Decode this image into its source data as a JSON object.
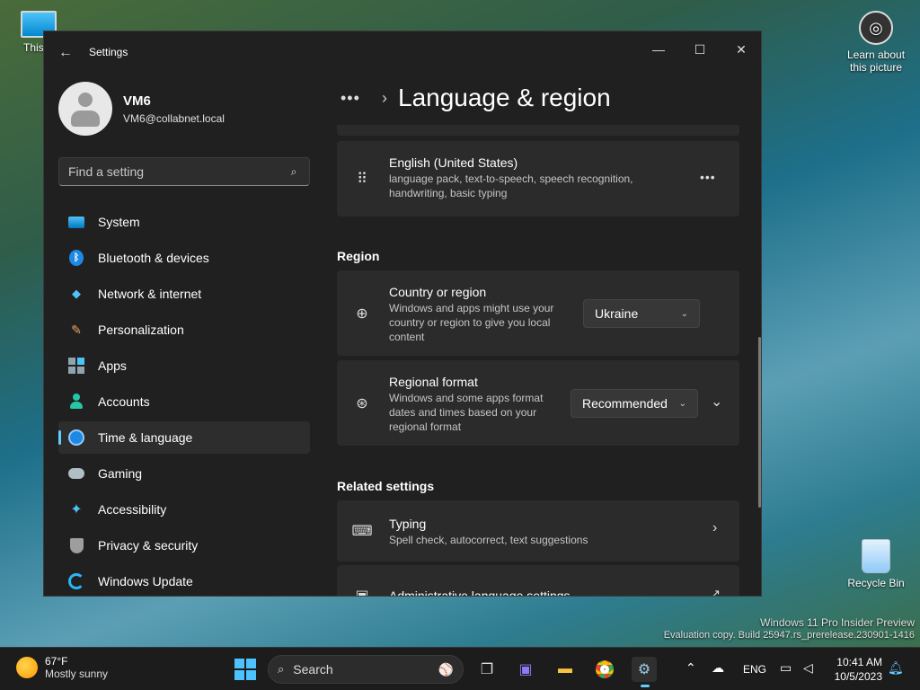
{
  "desktop": {
    "this_pc_label": "This P",
    "learn_label_1": "Learn about",
    "learn_label_2": "this picture",
    "recycle_label": "Recycle Bin",
    "watermark_line1": "Windows 11 Pro Insider Preview",
    "watermark_line2": "Evaluation copy. Build 25947.rs_prerelease.230901-1416"
  },
  "window": {
    "title": "Settings",
    "controls": {
      "minimize": "—",
      "maximize": "☐",
      "close": "✕"
    }
  },
  "profile": {
    "name": "VM6",
    "email": "VM6@collabnet.local"
  },
  "search": {
    "placeholder": "Find a setting"
  },
  "nav": [
    {
      "label": "System",
      "icon": "monitor-icon"
    },
    {
      "label": "Bluetooth & devices",
      "icon": "bluetooth-icon"
    },
    {
      "label": "Network & internet",
      "icon": "wifi-icon"
    },
    {
      "label": "Personalization",
      "icon": "brush-icon"
    },
    {
      "label": "Apps",
      "icon": "apps-icon"
    },
    {
      "label": "Accounts",
      "icon": "person-icon"
    },
    {
      "label": "Time & language",
      "icon": "clock-globe-icon",
      "active": true
    },
    {
      "label": "Gaming",
      "icon": "gamepad-icon"
    },
    {
      "label": "Accessibility",
      "icon": "accessibility-icon"
    },
    {
      "label": "Privacy & security",
      "icon": "shield-icon"
    },
    {
      "label": "Windows Update",
      "icon": "update-icon"
    }
  ],
  "header": {
    "breadcrumb_more": "•••",
    "breadcrumb_sep": "›",
    "title": "Language & region"
  },
  "language": {
    "name": "English (United States)",
    "desc_line1": "language pack, text-to-speech, speech recognition,",
    "desc_line2": "handwriting, basic typing",
    "more": "•••"
  },
  "region": {
    "heading": "Region",
    "country": {
      "title": "Country or region",
      "desc_line1": "Windows and apps might use your",
      "desc_line2": "country or region to give you local",
      "desc_line3": "content",
      "value": "Ukraine"
    },
    "format": {
      "title": "Regional format",
      "desc_line1": "Windows and some apps format",
      "desc_line2": "dates and times based on your",
      "desc_line3": "regional format",
      "value": "Recommended"
    }
  },
  "related": {
    "heading": "Related settings",
    "typing": {
      "title": "Typing",
      "desc": "Spell check, autocorrect, text suggestions"
    },
    "admin": {
      "title": "Administrative language settings"
    }
  },
  "taskbar": {
    "weather_temp": "67°F",
    "weather_cond": "Mostly sunny",
    "search_label": "Search",
    "lang": "ENG",
    "time": "10:41 AM",
    "date": "10/5/2023"
  },
  "colors": {
    "accent": "#60cdff",
    "window_bg": "#202020",
    "card_bg": "#2b2b2b"
  }
}
